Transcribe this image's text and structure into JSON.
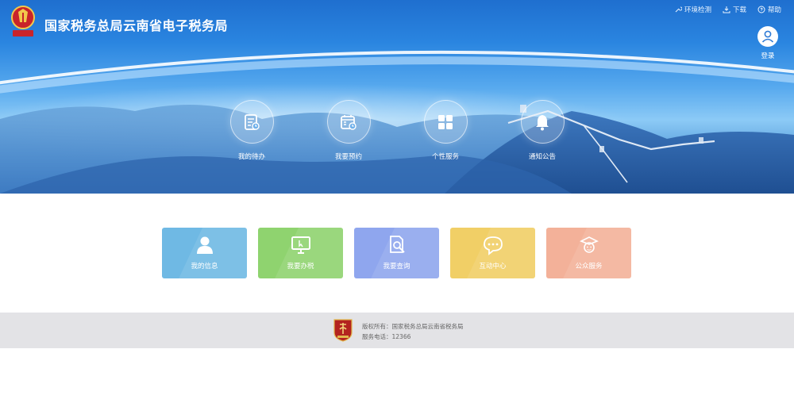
{
  "header": {
    "title": "国家税务总局云南省电子税务局",
    "top_links": [
      {
        "icon": "tools-icon",
        "label": "环境检测"
      },
      {
        "icon": "download-icon",
        "label": "下载"
      },
      {
        "icon": "help-icon",
        "label": "帮助"
      }
    ],
    "login_label": "登录"
  },
  "quick_actions": [
    {
      "icon": "todo-list-icon",
      "label": "我的待办"
    },
    {
      "icon": "calendar-icon",
      "label": "我要预约"
    },
    {
      "icon": "grid-icon",
      "label": "个性服务"
    },
    {
      "icon": "bell-icon",
      "label": "通知公告"
    }
  ],
  "tiles": [
    {
      "icon": "user-icon",
      "label": "我的信息",
      "color": "#6fb9e4"
    },
    {
      "icon": "monitor-icon",
      "label": "我要办税",
      "color": "#8fd36f"
    },
    {
      "icon": "search-document-icon",
      "label": "我要查询",
      "color": "#8fa6ee"
    },
    {
      "icon": "chat-icon",
      "label": "互动中心",
      "color": "#f1cf66"
    },
    {
      "icon": "public-service-icon",
      "label": "公众服务",
      "color": "#f3b199"
    }
  ],
  "footer": {
    "copyright": "版权所有：国家税务总局云南省税务局",
    "phone": "服务电话：12366"
  },
  "colors": {
    "banner_top": "#1f6fcf",
    "footer_bg": "#e3e3e6"
  }
}
